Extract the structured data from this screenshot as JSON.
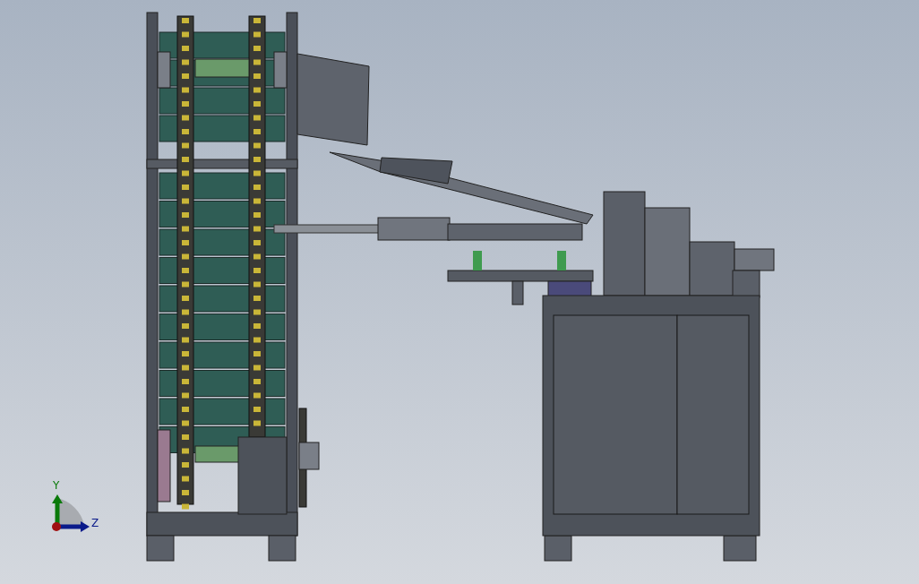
{
  "viewport": {
    "triad": {
      "axes": [
        {
          "kind": "vertical",
          "label": "Y",
          "color": "#0a7a0a"
        },
        {
          "kind": "horizontal",
          "label": "Z",
          "color": "#0a1a8a"
        }
      ]
    }
  }
}
